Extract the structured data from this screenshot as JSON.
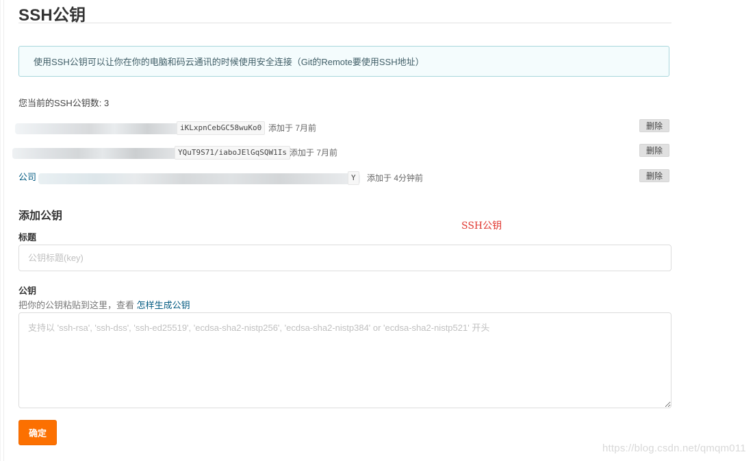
{
  "page": {
    "title": "SSH公钥"
  },
  "info": {
    "text": "使用SSH公钥可以让你在你的电脑和码云通讯的时候使用安全连接（Git的Remote要使用SSH地址）"
  },
  "keys": {
    "count_label": "您当前的SSH公钥数: 3",
    "items": [
      {
        "name": "",
        "fingerprint": "iKLxpnCebGC58wuKo0",
        "added": "添加于 7月前",
        "delete_label": "删除"
      },
      {
        "name": "",
        "fingerprint": "YQuT9S71/iaboJElGqSQW1Is",
        "added": "添加于 7月前",
        "delete_label": "删除"
      },
      {
        "name": "公司",
        "fingerprint": "Y",
        "added": "添加于 4分钟前",
        "delete_label": "删除"
      }
    ]
  },
  "add_key": {
    "section_title": "添加公钥",
    "annotation": "SSH公钥",
    "title_label": "标题",
    "title_placeholder": "公钥标题(key)",
    "key_label": "公钥",
    "key_hint": "把你的公钥粘贴到这里，查看",
    "key_hint_link": "怎样生成公钥",
    "key_placeholder": "支持以 'ssh-rsa', 'ssh-dss', 'ssh-ed25519', 'ecdsa-sha2-nistp256', 'ecdsa-sha2-nistp384' or 'ecdsa-sha2-nistp521' 开头",
    "submit_label": "确定"
  },
  "watermark": "https://blog.csdn.net/qmqm011"
}
